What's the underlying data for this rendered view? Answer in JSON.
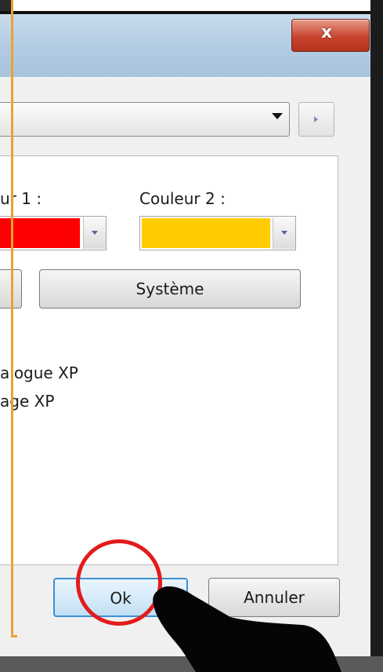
{
  "window": {
    "close_glyph": "x"
  },
  "colors": {
    "couleur1": "#ff0000",
    "couleur2": "#ffcc00"
  },
  "panel": {
    "couleur1_label": "ur 1 :",
    "couleur2_label": "Couleur 2 :",
    "system_button": "Système",
    "option1": "alogue XP",
    "option2": "age XP"
  },
  "footer": {
    "ok_button": "Ok",
    "cancel_button": "Annuler"
  }
}
